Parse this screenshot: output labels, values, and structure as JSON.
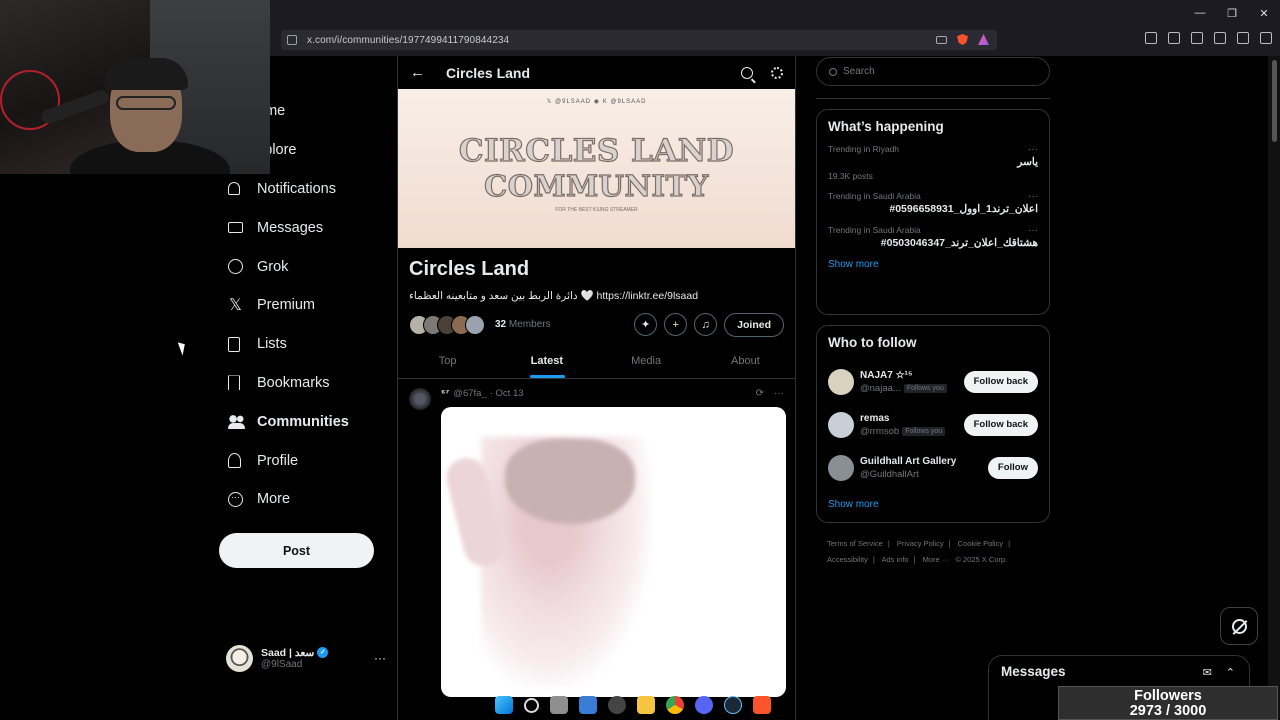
{
  "browser": {
    "url": "x.com/i/communities/1977499411790844234"
  },
  "nav": {
    "items": [
      {
        "label": "Home",
        "visible_label": "ome",
        "icon": "home-icon"
      },
      {
        "label": "Explore",
        "visible_label": "xplore",
        "icon": "search-icon"
      },
      {
        "label": "Notifications",
        "icon": "bell-icon"
      },
      {
        "label": "Messages",
        "icon": "envelope-icon"
      },
      {
        "label": "Grok",
        "icon": "grok-icon"
      },
      {
        "label": "Premium",
        "icon": "x-logo-icon"
      },
      {
        "label": "Lists",
        "icon": "list-icon"
      },
      {
        "label": "Bookmarks",
        "icon": "bookmark-icon"
      },
      {
        "label": "Communities",
        "icon": "people-icon",
        "active": true
      },
      {
        "label": "Profile",
        "icon": "person-icon"
      },
      {
        "label": "More",
        "icon": "more-circle-icon"
      }
    ],
    "post_button": "Post"
  },
  "account": {
    "name": "Saad | سعد",
    "handle": "@9lSaad",
    "more": "···"
  },
  "community": {
    "header_title": "Circles Land",
    "back": "←",
    "banner": {
      "handles": "𝕏 @9LSAAD   ◉   K @9LSAAD",
      "line1": "CIRCLES LAND",
      "line2": "COMMUNITY",
      "tagline": "FOR THE BEST KSING STREAMER"
    },
    "name": "Circles Land",
    "description": "دائرة الربط بين سعد و متابعينه العظماء 🤍 https://linktr.ee/9lsaad",
    "member_count": "32",
    "members_label": "Members",
    "joined_label": "Joined",
    "member_avatar_colors": [
      "#b7b2a8",
      "#7c7a76",
      "#4a4038",
      "#8c6a52",
      "#9aa3ad"
    ]
  },
  "tabs": [
    {
      "label": "Top"
    },
    {
      "label": "Latest",
      "active": true
    },
    {
      "label": "Media"
    },
    {
      "label": "About"
    }
  ],
  "tweet": {
    "name": "⁶⁷",
    "handle": "@67fa_",
    "date": "· Oct 13",
    "more": "···"
  },
  "right": {
    "search_placeholder": "Search",
    "whats_happening": {
      "title": "What’s happening",
      "trends": [
        {
          "context": "Trending in Riyadh",
          "topic": "ياسر",
          "posts": "19.3K posts"
        },
        {
          "context": "Trending in Saudi Arabia",
          "topic": "#اعلان_ترند1_اوول_0596658931",
          "posts": ""
        },
        {
          "context": "Trending in Saudi Arabia",
          "topic": "#هشتاقك_اعلان_ترند_0503046347",
          "posts": ""
        }
      ],
      "show_more": "Show more"
    },
    "who_to_follow": {
      "title": "Who to follow",
      "accounts": [
        {
          "name": "NAJA7 ☆¹⁵",
          "handle": "@najaa...",
          "follows_you": "Follows you",
          "button": "Follow back",
          "avatar_color": "#d8d2bf"
        },
        {
          "name": "remas",
          "handle": "@rrmsob",
          "follows_you": "Follows you",
          "button": "Follow back",
          "avatar_color": "#c9cfd6"
        },
        {
          "name": "Guildhall Art Gallery",
          "handle": "@GuildhallArt",
          "follows_you": "",
          "button": "Follow",
          "avatar_color": "#8a8f95"
        }
      ],
      "show_more": "Show more"
    },
    "footer": [
      "Terms of Service",
      "Privacy Policy",
      "Cookie Policy",
      "Accessibility",
      "Ads info",
      "More ···",
      "© 2025 X Corp."
    ]
  },
  "messages_drawer": {
    "title": "Messages"
  },
  "overlay": {
    "followers_label": "Followers",
    "followers_value": "2973 / 3000",
    "followers_current": 2973,
    "followers_goal": 3000
  }
}
